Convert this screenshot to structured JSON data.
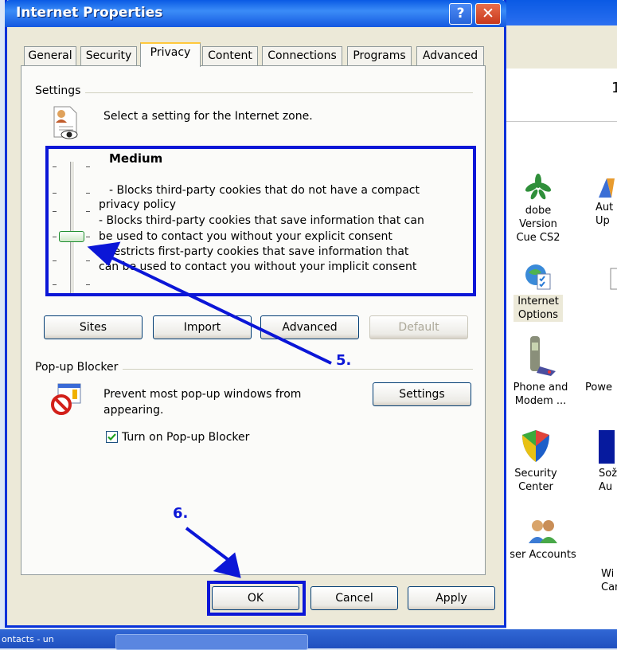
{
  "dialog": {
    "title": "Internet Properties",
    "help_glyph": "?",
    "close_glyph": "✕"
  },
  "tabs": [
    {
      "label": "General",
      "active": false
    },
    {
      "label": "Security",
      "active": false
    },
    {
      "label": "Privacy",
      "active": true
    },
    {
      "label": "Content",
      "active": false
    },
    {
      "label": "Connections",
      "active": false
    },
    {
      "label": "Programs",
      "active": false
    },
    {
      "label": "Advanced",
      "active": false
    }
  ],
  "settings": {
    "group_label": "Settings",
    "zone_text": "Select a setting for the Internet zone.",
    "level": "Medium",
    "level_position": "3 of 6",
    "description": [
      "- Blocks third-party cookies that do not have a compact",
      "privacy policy",
      "- Blocks third-party cookies that save information that can",
      "be used to contact you without your explicit consent",
      "- Restricts first-party cookies that save information that",
      "can be used to contact you without your implicit consent"
    ],
    "buttons": {
      "sites": "Sites",
      "import": "Import",
      "advanced": "Advanced",
      "default": "Default"
    }
  },
  "popup": {
    "group_label": "Pop-up Blocker",
    "text_line1": "Prevent most pop-up windows from",
    "text_line2": "appearing.",
    "settings_button": "Settings",
    "checkbox_label": "Turn on Pop-up Blocker",
    "checkbox_checked": true
  },
  "footer": {
    "ok": "OK",
    "cancel": "Cancel",
    "apply": "Apply"
  },
  "annotations": {
    "step5": "5.",
    "step6": "6.",
    "color": "#0b16d7"
  },
  "background": {
    "items": [
      {
        "label1": "dobe Version",
        "label2": "Cue CS2"
      },
      {
        "label1": "Aut",
        "label2": "Up"
      },
      {
        "label1": "Internet",
        "label2": "Options"
      },
      {
        "label1": "Phone and",
        "label2": "Modem ..."
      },
      {
        "label1": "Powe",
        "label2": ""
      },
      {
        "label1": "Security",
        "label2": "Center"
      },
      {
        "label1": "Sož",
        "label2": "Au"
      },
      {
        "label1": "ser Accounts",
        "label2": ""
      },
      {
        "label1": "Wi",
        "label2": "Car"
      }
    ],
    "corner_number": "1"
  },
  "taskbar": {
    "text": "ontacts - un"
  }
}
